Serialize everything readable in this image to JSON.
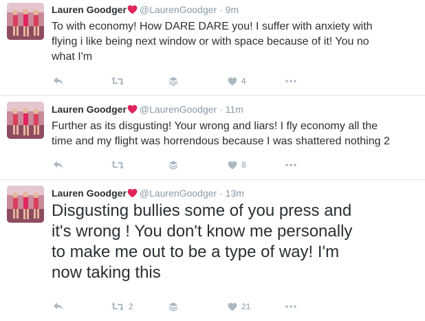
{
  "tweets": [
    {
      "name": "Lauren Goodger",
      "handle": "@LaurenGoodger",
      "separator": "·",
      "time": "9m",
      "text_lines": [
        "To with economy! How DARE DARE you! I suffer with anxiety with",
        "flying i like being next window or with space because of it! You no",
        "what I'm"
      ],
      "retweets": "",
      "likes": "4"
    },
    {
      "name": "Lauren Goodger",
      "handle": "@LaurenGoodger",
      "separator": "·",
      "time": "11m",
      "text_lines": [
        "Further as its disgusting! Your wrong and liars! I fly economy all the",
        "time and my flight was horrendous because I was shattered nothing 2"
      ],
      "retweets": "",
      "likes": "8"
    },
    {
      "name": "Lauren Goodger",
      "handle": "@LaurenGoodger",
      "separator": "·",
      "time": "13m",
      "text_lines": [
        "Disgusting bullies some of you press and",
        "it's wrong ! You don't know me personally",
        "to make me out to be a type of way! I'm",
        "now taking this"
      ],
      "retweets": "2",
      "likes": "21"
    }
  ],
  "icons": {
    "verified_heart": "heart-emoji",
    "reply": "reply-icon",
    "retweet": "retweet-icon",
    "buffer": "buffer-icon",
    "like": "like-icon",
    "more": "more-icon"
  },
  "colors": {
    "heart": "#e0245e",
    "icon": "#aab8c2",
    "muted": "#8899a6",
    "text": "#292f33"
  }
}
